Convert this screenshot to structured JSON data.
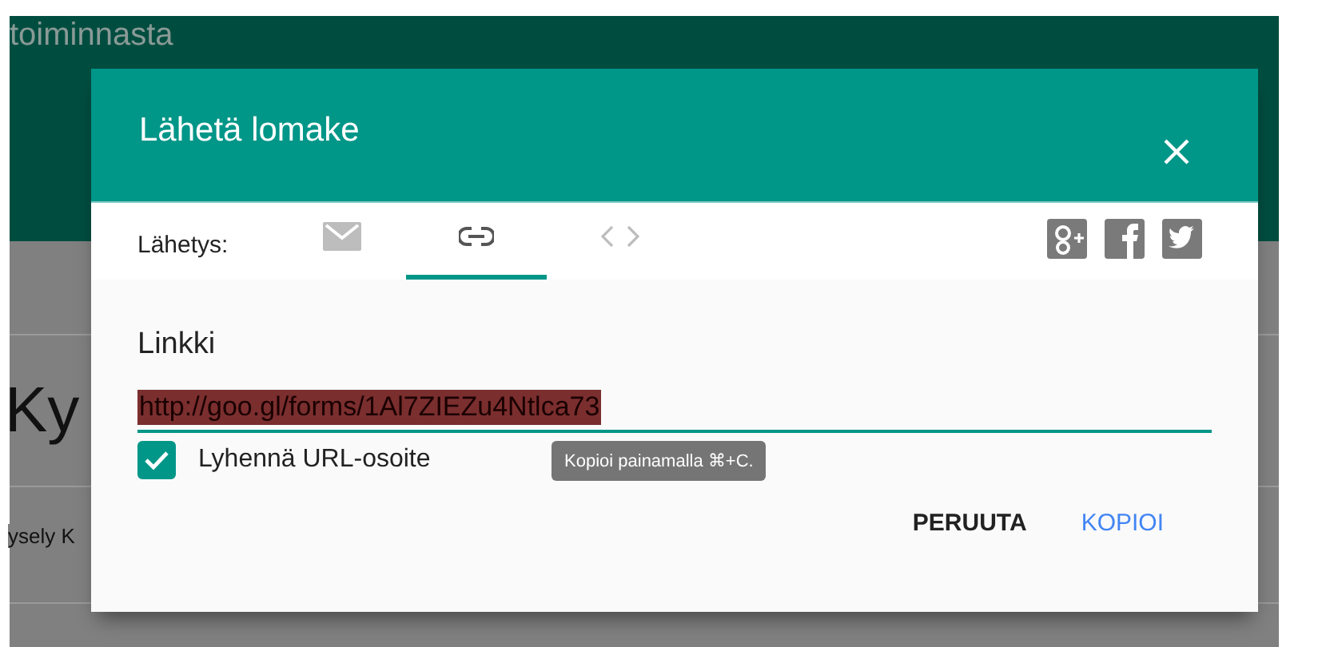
{
  "page": {
    "header_title": "toiminnasta",
    "heading": "Ky",
    "subtitle": "ysely K"
  },
  "dialog": {
    "title": "Lähetä lomake",
    "share_label": "Lähetys:",
    "tabs": [
      {
        "kind": "email",
        "selected": false
      },
      {
        "kind": "link",
        "selected": true
      },
      {
        "kind": "embed",
        "selected": false
      }
    ],
    "section_title": "Linkki",
    "url": "http://goo.gl/forms/1Al7ZIEZu4Ntlca73",
    "url_selected": true,
    "shorten": {
      "label": "Lyhennä URL-osoite",
      "checked": true
    },
    "tooltip": "Kopioi painamalla ⌘+C.",
    "buttons": [
      {
        "label": "PERUUTA",
        "kind": "cancel"
      },
      {
        "label": "KOPIOI",
        "kind": "primary"
      }
    ]
  }
}
